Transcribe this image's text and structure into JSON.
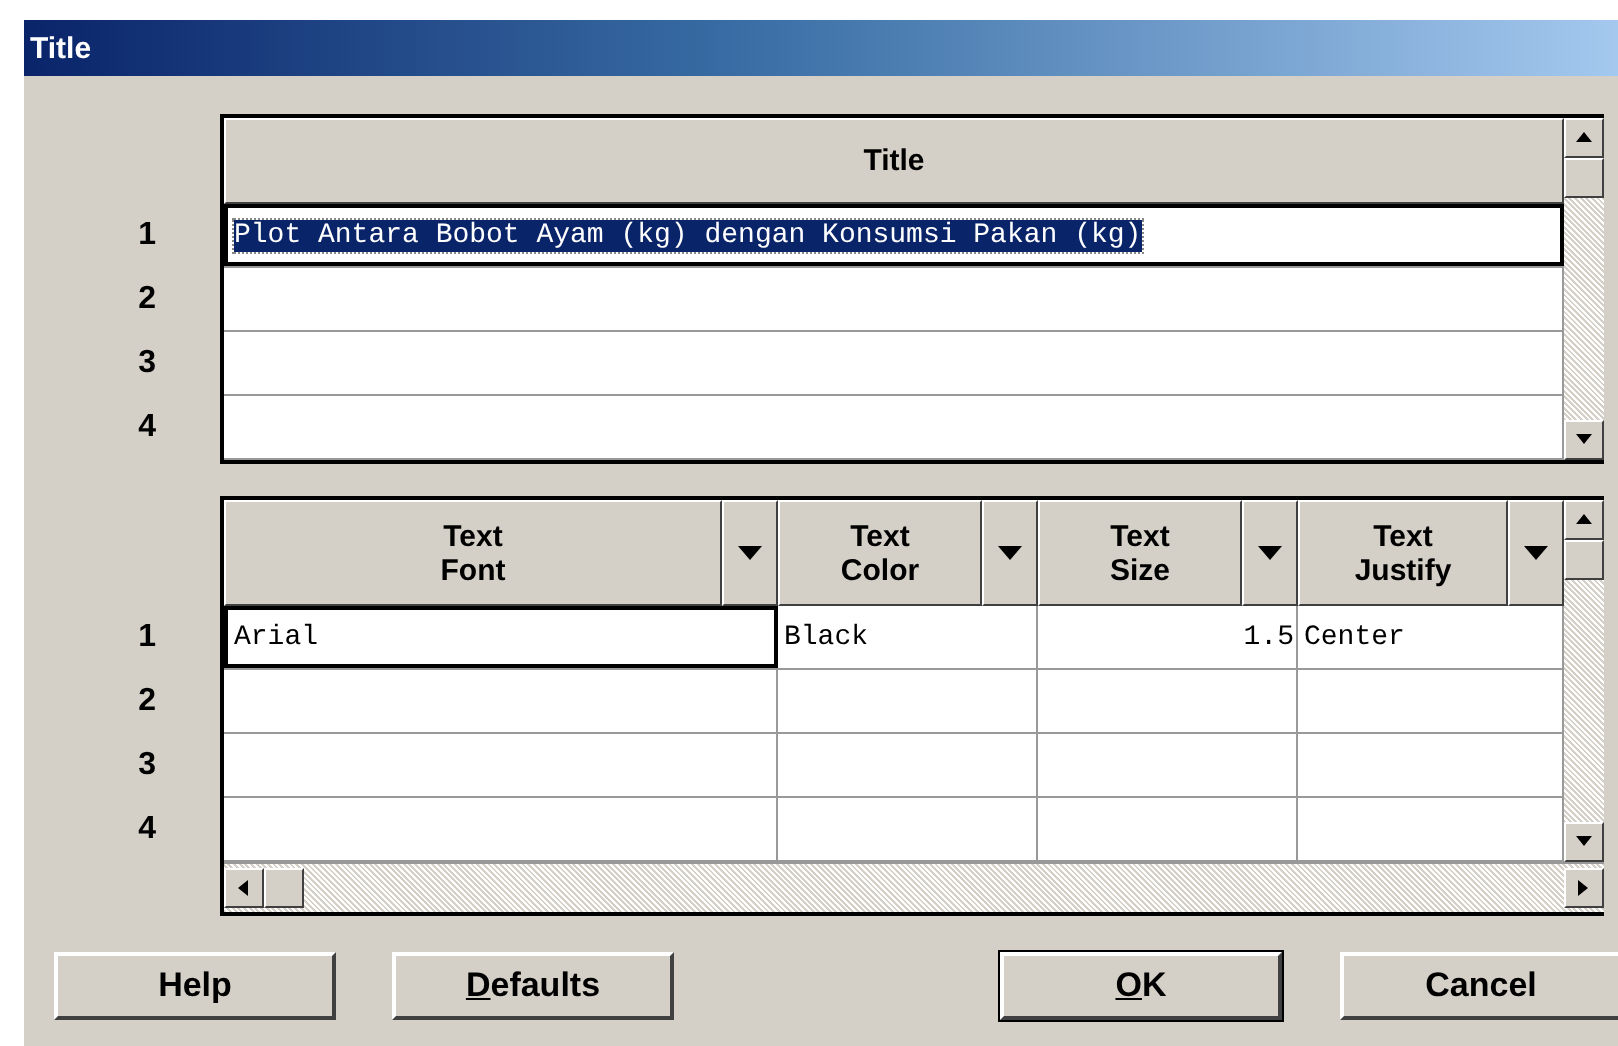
{
  "window": {
    "title": "Title"
  },
  "title_grid": {
    "columns": [
      {
        "label": "Title"
      }
    ],
    "rows": [
      {
        "number": "1",
        "cells": [
          {
            "value": "Plot Antara Bobot Ayam (kg) dengan Konsumsi Pakan (kg)",
            "selected": true,
            "focused": true
          }
        ]
      },
      {
        "number": "2"
      },
      {
        "number": "3"
      },
      {
        "number": "4"
      }
    ]
  },
  "text_grid": {
    "columns": [
      {
        "label": "Text\nFont",
        "dropdown": true,
        "kind": "text"
      },
      {
        "label": "Text\nColor",
        "dropdown": true,
        "kind": "text"
      },
      {
        "label": "Text\nSize",
        "dropdown": true,
        "kind": "number"
      },
      {
        "label": "Text\nJustify",
        "dropdown": true,
        "kind": "text"
      }
    ],
    "rows": [
      {
        "number": "1",
        "cells": [
          {
            "value": "Arial",
            "selected": false,
            "focused": true
          },
          {
            "value": "Black",
            "selected": false,
            "focused": false
          },
          {
            "value": "1.5",
            "selected": false,
            "focused": false
          },
          {
            "value": "Center",
            "selected": false,
            "focused": false
          }
        ]
      },
      {
        "number": "2"
      },
      {
        "number": "3"
      },
      {
        "number": "4"
      }
    ]
  },
  "buttons": [
    {
      "label": "Help",
      "mnemonic": false,
      "default": false
    },
    {
      "label": "Defaults",
      "mnemonic": true,
      "default": false
    },
    {
      "label": "OK",
      "mnemonic": true,
      "default": true
    },
    {
      "label": "Cancel",
      "mnemonic": false,
      "default": false
    }
  ]
}
